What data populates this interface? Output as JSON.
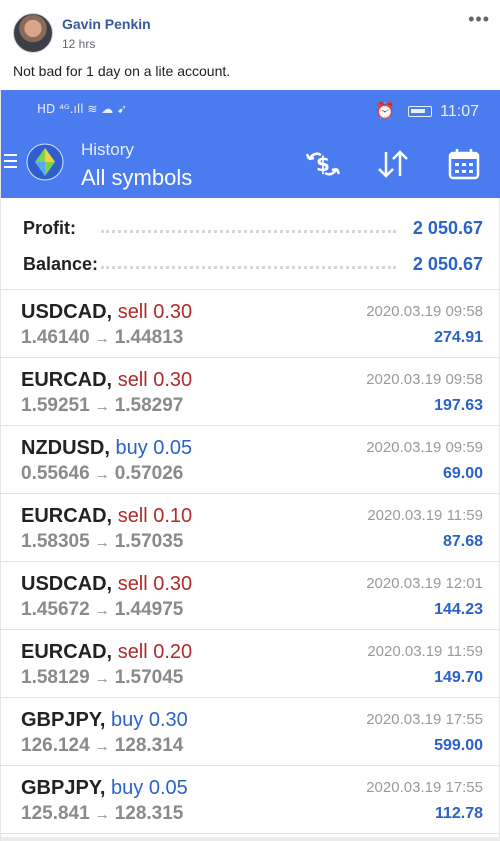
{
  "post": {
    "author": "Gavin Penkin",
    "time": "12 hrs",
    "text": "Not bad for 1 day on a lite account.",
    "more_label": "•••"
  },
  "status_bar": {
    "left": "HD ⁴ᴳ.ıll ≋ ☁ ➹",
    "clock": "11:07",
    "alarm_glyph": "⏰"
  },
  "appbar": {
    "title": "History",
    "subtitle": "All symbols",
    "icons": [
      "menu-icon",
      "metatrader-logo-icon",
      "currency-swap-icon",
      "sort-icon",
      "calendar-icon"
    ],
    "color": "#4a7cf0"
  },
  "summary": {
    "profit_label": "Profit:",
    "profit_value": "2 050.67",
    "balance_label": "Balance:",
    "balance_value": "2 050.67"
  },
  "colors": {
    "sell": "#b22a2a",
    "buy": "#2a62c9",
    "profit": "#2a62c9"
  },
  "trades": [
    {
      "symbol": "USDCAD,",
      "side": "sell",
      "side_text": "sell 0.30",
      "open": "1.46140",
      "close": "1.44813",
      "arrow": "→",
      "datetime": "2020.03.19 09:58",
      "profit": "274.91"
    },
    {
      "symbol": "EURCAD,",
      "side": "sell",
      "side_text": "sell 0.30",
      "open": "1.59251",
      "close": "1.58297",
      "arrow": "→",
      "datetime": "2020.03.19 09:58",
      "profit": "197.63"
    },
    {
      "symbol": "NZDUSD,",
      "side": "buy",
      "side_text": "buy 0.05",
      "open": "0.55646",
      "close": "0.57026",
      "arrow": "→",
      "datetime": "2020.03.19 09:59",
      "profit": "69.00"
    },
    {
      "symbol": "EURCAD,",
      "side": "sell",
      "side_text": "sell 0.10",
      "open": "1.58305",
      "close": "1.57035",
      "arrow": "→",
      "datetime": "2020.03.19 11:59",
      "profit": "87.68"
    },
    {
      "symbol": "USDCAD,",
      "side": "sell",
      "side_text": "sell 0.30",
      "open": "1.45672",
      "close": "1.44975",
      "arrow": "→",
      "datetime": "2020.03.19 12:01",
      "profit": "144.23"
    },
    {
      "symbol": "EURCAD,",
      "side": "sell",
      "side_text": "sell 0.20",
      "open": "1.58129",
      "close": "1.57045",
      "arrow": "→",
      "datetime": "2020.03.19 11:59",
      "profit": "149.70"
    },
    {
      "symbol": "GBPJPY,",
      "side": "buy",
      "side_text": "buy 0.30",
      "open": "126.124",
      "close": "128.314",
      "arrow": "→",
      "datetime": "2020.03.19 17:55",
      "profit": "599.00"
    },
    {
      "symbol": "GBPJPY,",
      "side": "buy",
      "side_text": "buy 0.05",
      "open": "125.841",
      "close": "128.315",
      "arrow": "→",
      "datetime": "2020.03.19 17:55",
      "profit": "112.78"
    }
  ]
}
